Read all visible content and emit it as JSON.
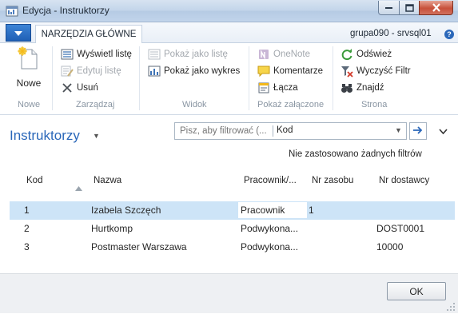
{
  "window": {
    "title": "Edycja - Instruktorzy",
    "controls": {
      "minimize": "–",
      "maximize": "□",
      "close": "✕"
    }
  },
  "ribbon": {
    "app_menu_icon": "dropdown-arrow-icon",
    "active_tab": "NARZĘDZIA GŁÓWNE",
    "context": "grupa090 - srvsql01",
    "help_icon": "?",
    "groups": {
      "nowe": {
        "label": "Nowe",
        "new_button": {
          "label": "Nowe",
          "icon": "new-document-icon"
        }
      },
      "zarzadzaj": {
        "label": "Zarządzaj",
        "view_list": {
          "label": "Wyświetl listę",
          "icon": "list-view-icon",
          "enabled": true
        },
        "edit_list": {
          "label": "Edytuj listę",
          "icon": "edit-list-icon",
          "enabled": false
        },
        "delete": {
          "label": "Usuń",
          "icon": "delete-x-icon",
          "enabled": true
        }
      },
      "widok": {
        "label": "Widok",
        "show_as_list": {
          "label": "Pokaż jako listę",
          "icon": "show-list-icon",
          "enabled": false
        },
        "show_as_chart": {
          "label": "Pokaż jako wykres",
          "icon": "chart-icon",
          "enabled": true
        }
      },
      "zalaczone": {
        "label": "Pokaż załączone",
        "onenote": {
          "label": "OneNote",
          "icon": "onenote-icon",
          "enabled": false
        },
        "comments": {
          "label": "Komentarze",
          "icon": "comment-icon",
          "enabled": true
        },
        "links": {
          "label": "Łącza",
          "icon": "link-icon",
          "enabled": true
        }
      },
      "strona": {
        "label": "Strona",
        "refresh": {
          "label": "Odśwież",
          "icon": "refresh-icon",
          "enabled": true
        },
        "clear_filter": {
          "label": "Wyczyść Filtr",
          "icon": "clear-filter-icon",
          "enabled": true
        },
        "find": {
          "label": "Znajdź",
          "icon": "binoculars-icon",
          "enabled": true
        }
      }
    }
  },
  "page": {
    "title": "Instruktorzy",
    "filter": {
      "placeholder": "Pisz, aby filtrować (...",
      "field": "Kod"
    },
    "filter_status": "Nie zastosowano żadnych filtrów"
  },
  "grid": {
    "columns": [
      "Kod",
      "Nazwa",
      "Pracownik/...",
      "Nr zasobu",
      "Nr dostawcy"
    ],
    "sorted_column": "Kod",
    "rows": [
      {
        "kod": "1",
        "nazwa": "Izabela Szczęch",
        "pracownik": "Pracownik",
        "nr_zasobu": "1",
        "nr_dostawcy": "",
        "selected": true
      },
      {
        "kod": "2",
        "nazwa": "Hurtkomp",
        "pracownik": "Podwykona...",
        "nr_zasobu": "",
        "nr_dostawcy": "DOST0001",
        "selected": false
      },
      {
        "kod": "3",
        "nazwa": "Postmaster Warszawa",
        "pracownik": "Podwykona...",
        "nr_zasobu": "",
        "nr_dostawcy": "10000",
        "selected": false
      }
    ]
  },
  "footer": {
    "ok_label": "OK"
  },
  "colors": {
    "accent": "#2a67b9",
    "selected_row": "#cde4f7",
    "ribbon_tab_bg": "#e9eff7",
    "disabled_text": "#a3a8ae"
  }
}
